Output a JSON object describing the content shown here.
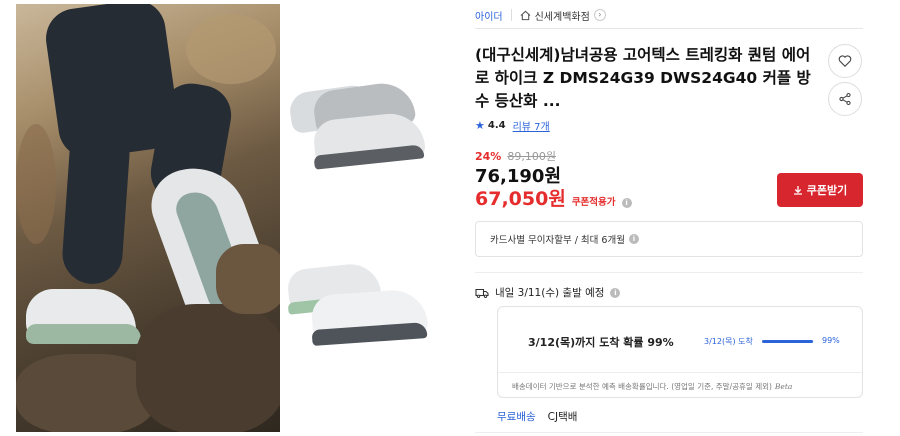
{
  "header": {
    "brand": "아이더",
    "store": "신세계백화점"
  },
  "product": {
    "title": "(대구신세계)남녀공용 고어텍스 트레킹화 퀀텀 에어로 하이크 Z DMS24G39 DWS24G40 커플 방수 등산화 ...",
    "rating": "4.4",
    "review_label": "리뷰 7개"
  },
  "pricing": {
    "discount": "24%",
    "original_price": "89,100원",
    "price": "76,190원",
    "coupon_price": "67,050원",
    "coupon_applied_label": "쿠폰적용가",
    "coupon_button": "쿠폰받기"
  },
  "card_info": "카드사별 무이자할부 / 최대 6개월",
  "delivery": {
    "schedule": "내일 3/11(수) 출발 예정",
    "arrival": "3/12(목)까지 도착 확률 99%",
    "bar_label": "3/12(목) 도착",
    "bar_pct": "99%",
    "bar_fraction": 0.99,
    "note": "배송데이터 기반으로 분석한 예측 배송확률입니다. (영업일 기준, 주말/공휴일 제외)",
    "beta": "Beta",
    "free_shipping": "무료배송",
    "carrier": "CJ택배"
  },
  "colors": {
    "accent_blue": "#2b63d9",
    "sale_red": "#e62d2d",
    "button_red": "#d8262e"
  }
}
